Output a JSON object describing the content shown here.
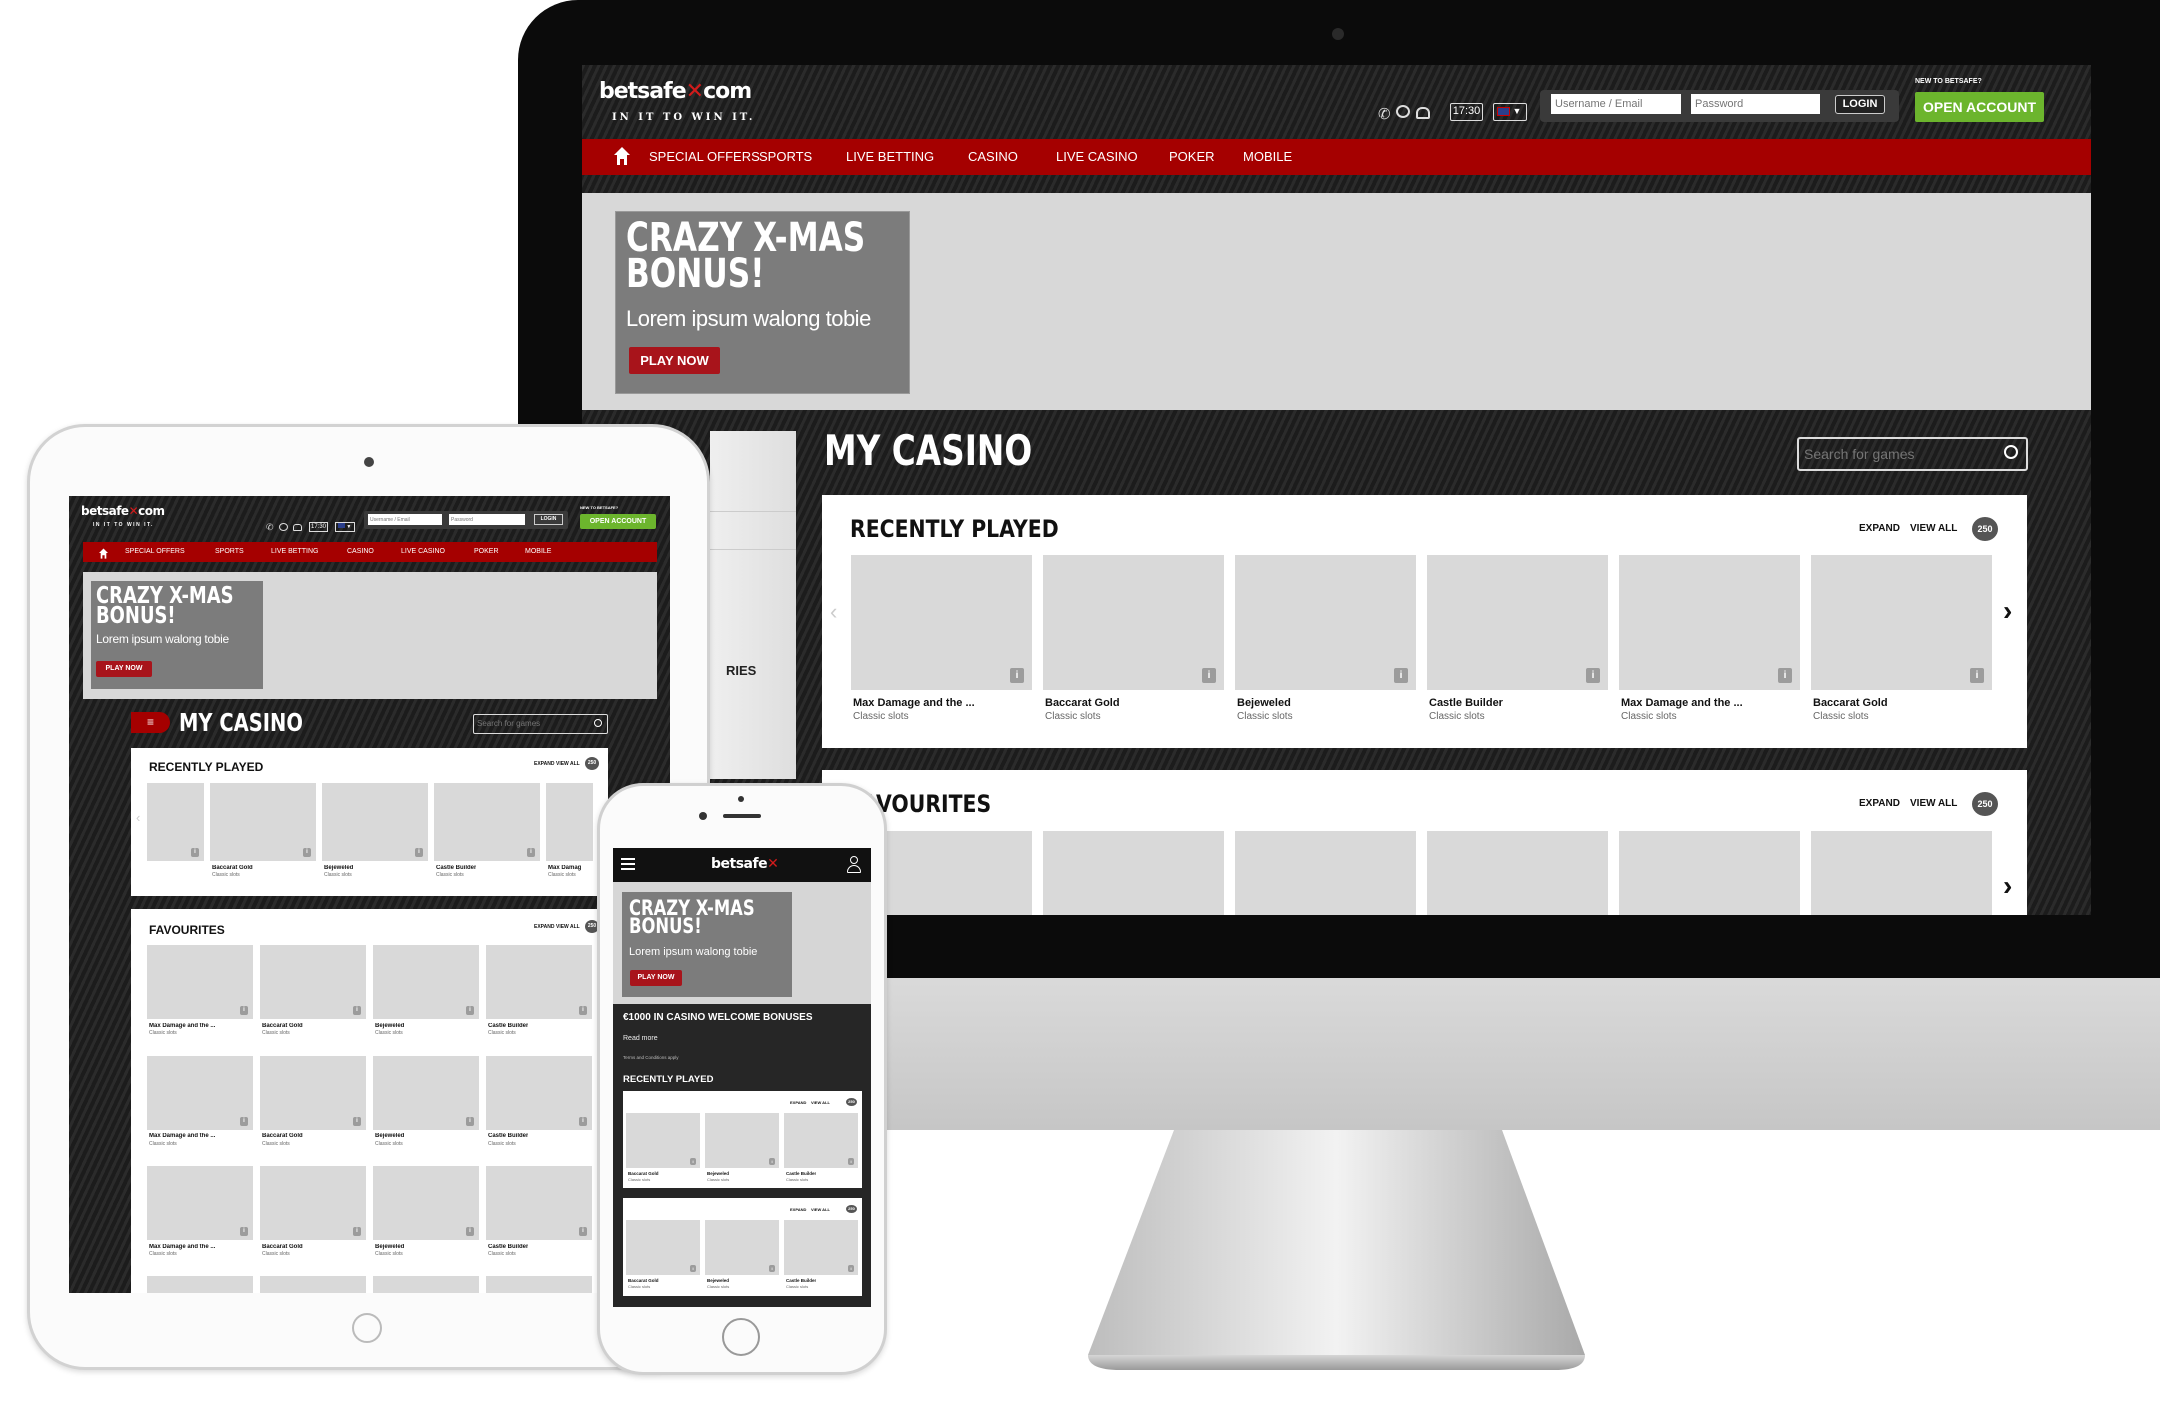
{
  "brand": {
    "name_left": "betsafe",
    "name_right": "com",
    "tagline": "IN IT TO WIN IT.",
    "mobile_name": "betsafe"
  },
  "header": {
    "time": "17:30",
    "username_placeholder": "Username / Email",
    "password_placeholder": "Password",
    "login_label": "LOGIN",
    "new_to": "NEW TO BETSAFE?",
    "open_account": "OPEN ACCOUNT"
  },
  "nav": {
    "items": [
      "SPECIAL OFFERS",
      "SPORTS",
      "LIVE BETTING",
      "CASINO",
      "LIVE CASINO",
      "POKER",
      "MOBILE"
    ]
  },
  "banner": {
    "title_line1": "CRAZY X-MAS",
    "title_line2": "BONUS!",
    "subtitle": "Lorem ipsum walong tobie",
    "cta": "PLAY NOW"
  },
  "casino": {
    "title": "MY CASINO",
    "search_placeholder": "Search for games",
    "expand": "EXPAND",
    "view_all": "VIEW ALL",
    "count": "250",
    "recent_title": "RECENTLY PLAYED",
    "favourites_title": "FAVOURITES",
    "sidebar_fragment": "RIES"
  },
  "colors": {
    "brand_red": "#a50000",
    "cta_red": "#a8141b",
    "open_account_green": "#6cb52d",
    "dark_bg": "#222222",
    "tile": "#d9d9d9"
  },
  "desktop": {
    "recent_games": [
      {
        "name": "Max Damage and the ...",
        "category": "Classic slots"
      },
      {
        "name": "Baccarat Gold",
        "category": "Classic slots"
      },
      {
        "name": "Bejeweled",
        "category": "Classic slots"
      },
      {
        "name": "Castle Builder",
        "category": "Classic slots"
      },
      {
        "name": "Max Damage and the ...",
        "category": "Classic slots"
      },
      {
        "name": "Baccarat Gold",
        "category": "Classic slots"
      }
    ]
  },
  "tablet": {
    "recent_games": [
      {
        "name": "and the ...",
        "category": ""
      },
      {
        "name": "Baccarat Gold",
        "category": "Classic slots"
      },
      {
        "name": "Bejeweled",
        "category": "Classic slots"
      },
      {
        "name": "Castle Builder",
        "category": "Classic slots"
      },
      {
        "name": "Max Damag",
        "category": "Classic slots"
      }
    ],
    "favourite_rows": [
      [
        {
          "name": "Max Damage and the ...",
          "category": "Classic slots"
        },
        {
          "name": "Baccarat Gold",
          "category": "Classic slots"
        },
        {
          "name": "Bejeweled",
          "category": "Classic slots"
        },
        {
          "name": "Castle Builder",
          "category": "Classic slots"
        }
      ],
      [
        {
          "name": "Max Damage and the ...",
          "category": "Classic slots"
        },
        {
          "name": "Baccarat Gold",
          "category": "Classic slots"
        },
        {
          "name": "Bejeweled",
          "category": "Classic slots"
        },
        {
          "name": "Castle Builder",
          "category": "Classic slots"
        }
      ],
      [
        {
          "name": "Max Damage and the ...",
          "category": "Classic slots"
        },
        {
          "name": "Baccarat Gold",
          "category": "Classic slots"
        },
        {
          "name": "Bejeweled",
          "category": "Classic slots"
        },
        {
          "name": "Castle Builder",
          "category": "Classic slots"
        }
      ]
    ]
  },
  "phone": {
    "promo_title": "€1000 IN CASINO WELCOME BONUSES",
    "read_more": "Read more",
    "terms": "Terms and Conditions apply",
    "recent_title": "RECENTLY PLAYED",
    "panels": [
      [
        {
          "name": "Baccarat Gold",
          "category": "Classic slots"
        },
        {
          "name": "Bejeweled",
          "category": "Classic slots"
        },
        {
          "name": "Castle Builder",
          "category": "Classic slots"
        }
      ],
      [
        {
          "name": "Baccarat Gold",
          "category": "Classic slots"
        },
        {
          "name": "Bejeweled",
          "category": "Classic slots"
        },
        {
          "name": "Castle Builder",
          "category": "Classic slots"
        }
      ]
    ]
  }
}
